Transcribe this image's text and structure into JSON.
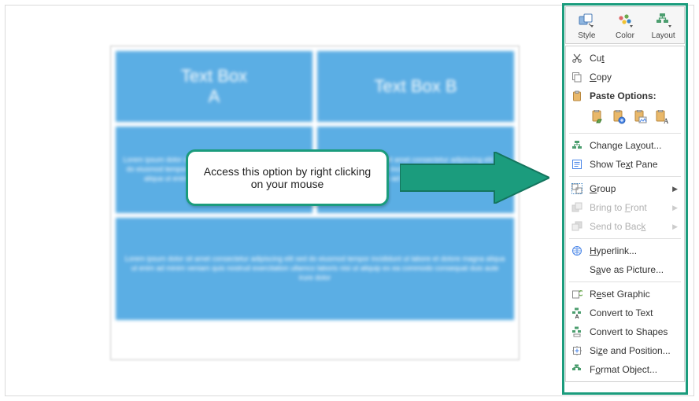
{
  "canvas": {
    "box_a": "Text Box\nA",
    "box_b": "Text Box B",
    "mid_left": "Lorem ipsum dolor sit amet consectetur adipiscing elit sed do eiusmod tempor incididunt ut labore et dolore magna aliqua ut enim ad minim veniam quis nostrud",
    "mid_right": "Lorem ipsum dolor sit amet consectetur adipiscing elit sed do eiusmod tempor incididunt ut labore et dolore magna aliqua ut enim ad minim veniam quis nostrud",
    "bottom": "Lorem ipsum dolor sit amet consectetur adipiscing elit sed do eiusmod tempor incididunt ut labore et dolore magna aliqua ut enim ad minim veniam quis nostrud exercitation ullamco laboris nisi ut aliquip ex ea commodo consequat duis aute irure dolor"
  },
  "callout": {
    "text": "Access this option by right clicking on your mouse"
  },
  "mini_toolbar": {
    "style": "Style",
    "color": "Color",
    "layout": "Layout"
  },
  "menu": {
    "cut": "Cut",
    "copy": "Copy",
    "paste_options": "Paste Options:",
    "change_layout": "Change Layout...",
    "show_text_pane": "Show Text Pane",
    "group": "Group",
    "bring_to_front": "Bring to Front",
    "send_to_back": "Send to Back",
    "hyperlink": "Hyperlink...",
    "save_as_picture": "Save as Picture...",
    "reset_graphic": "Reset Graphic",
    "convert_to_text": "Convert to Text",
    "convert_to_shapes": "Convert to Shapes",
    "size_and_position": "Size and Position...",
    "format_object": "Format Object..."
  }
}
